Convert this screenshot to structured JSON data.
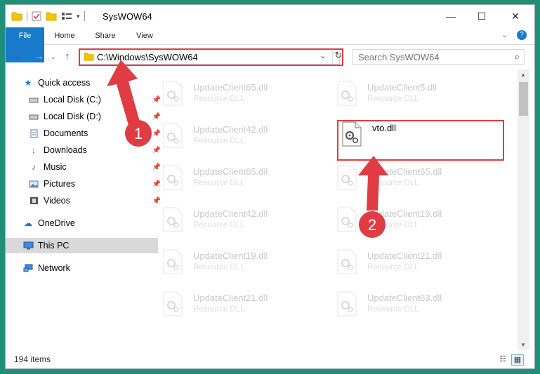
{
  "window": {
    "title": "SysWOW64"
  },
  "ribbon": {
    "tabs": [
      "File",
      "Home",
      "Share",
      "View"
    ]
  },
  "address": {
    "path": "C:\\Windows\\SysWOW64"
  },
  "search": {
    "placeholder": "Search SysWOW64"
  },
  "sidebar": {
    "items": [
      {
        "label": "Quick access",
        "icon": "star-icon"
      },
      {
        "label": "Local Disk (C:)",
        "icon": "drive-icon",
        "pinned": true
      },
      {
        "label": "Local Disk (D:)",
        "icon": "drive-icon",
        "pinned": true
      },
      {
        "label": "Documents",
        "icon": "documents-icon",
        "pinned": true
      },
      {
        "label": "Downloads",
        "icon": "downloads-icon",
        "pinned": true
      },
      {
        "label": "Music",
        "icon": "music-icon",
        "pinned": true
      },
      {
        "label": "Pictures",
        "icon": "pictures-icon",
        "pinned": true
      },
      {
        "label": "Videos",
        "icon": "videos-icon",
        "pinned": true
      },
      {
        "label": "OneDrive",
        "icon": "cloud-icon"
      },
      {
        "label": "This PC",
        "icon": "computer-icon",
        "selected": true
      },
      {
        "label": "Network",
        "icon": "network-icon"
      }
    ]
  },
  "files": [
    {
      "name": "UpdateClient65.dll",
      "type": "Resource DLL"
    },
    {
      "name": "UpdateClient5.dll",
      "type": "Resource DLL"
    },
    {
      "name": "UpdateClient42.dll",
      "type": "Resource DLL"
    },
    {
      "name": "vto.dll",
      "type": "",
      "highlighted": true
    },
    {
      "name": "UpdateClient65.dll",
      "type": "Resource DLL"
    },
    {
      "name": "UpdateClient65.dll",
      "type": "Resource DLL"
    },
    {
      "name": "UpdateClient42.dll",
      "type": "Resource DLL"
    },
    {
      "name": "UpdateClient19.dll",
      "type": "Resource DLL"
    },
    {
      "name": "UpdateClient19.dll",
      "type": "Resource DLL"
    },
    {
      "name": "UpdateClient21.dll",
      "type": "Resource DLL"
    },
    {
      "name": "UpdateClient21.dll",
      "type": "Resource DLL"
    },
    {
      "name": "UpdateClient63.dll",
      "type": "Resource DLL"
    }
  ],
  "status": {
    "item_count": "194 items"
  },
  "annotations": {
    "step1": "1",
    "step2": "2",
    "accent_color": "#e03c43"
  }
}
